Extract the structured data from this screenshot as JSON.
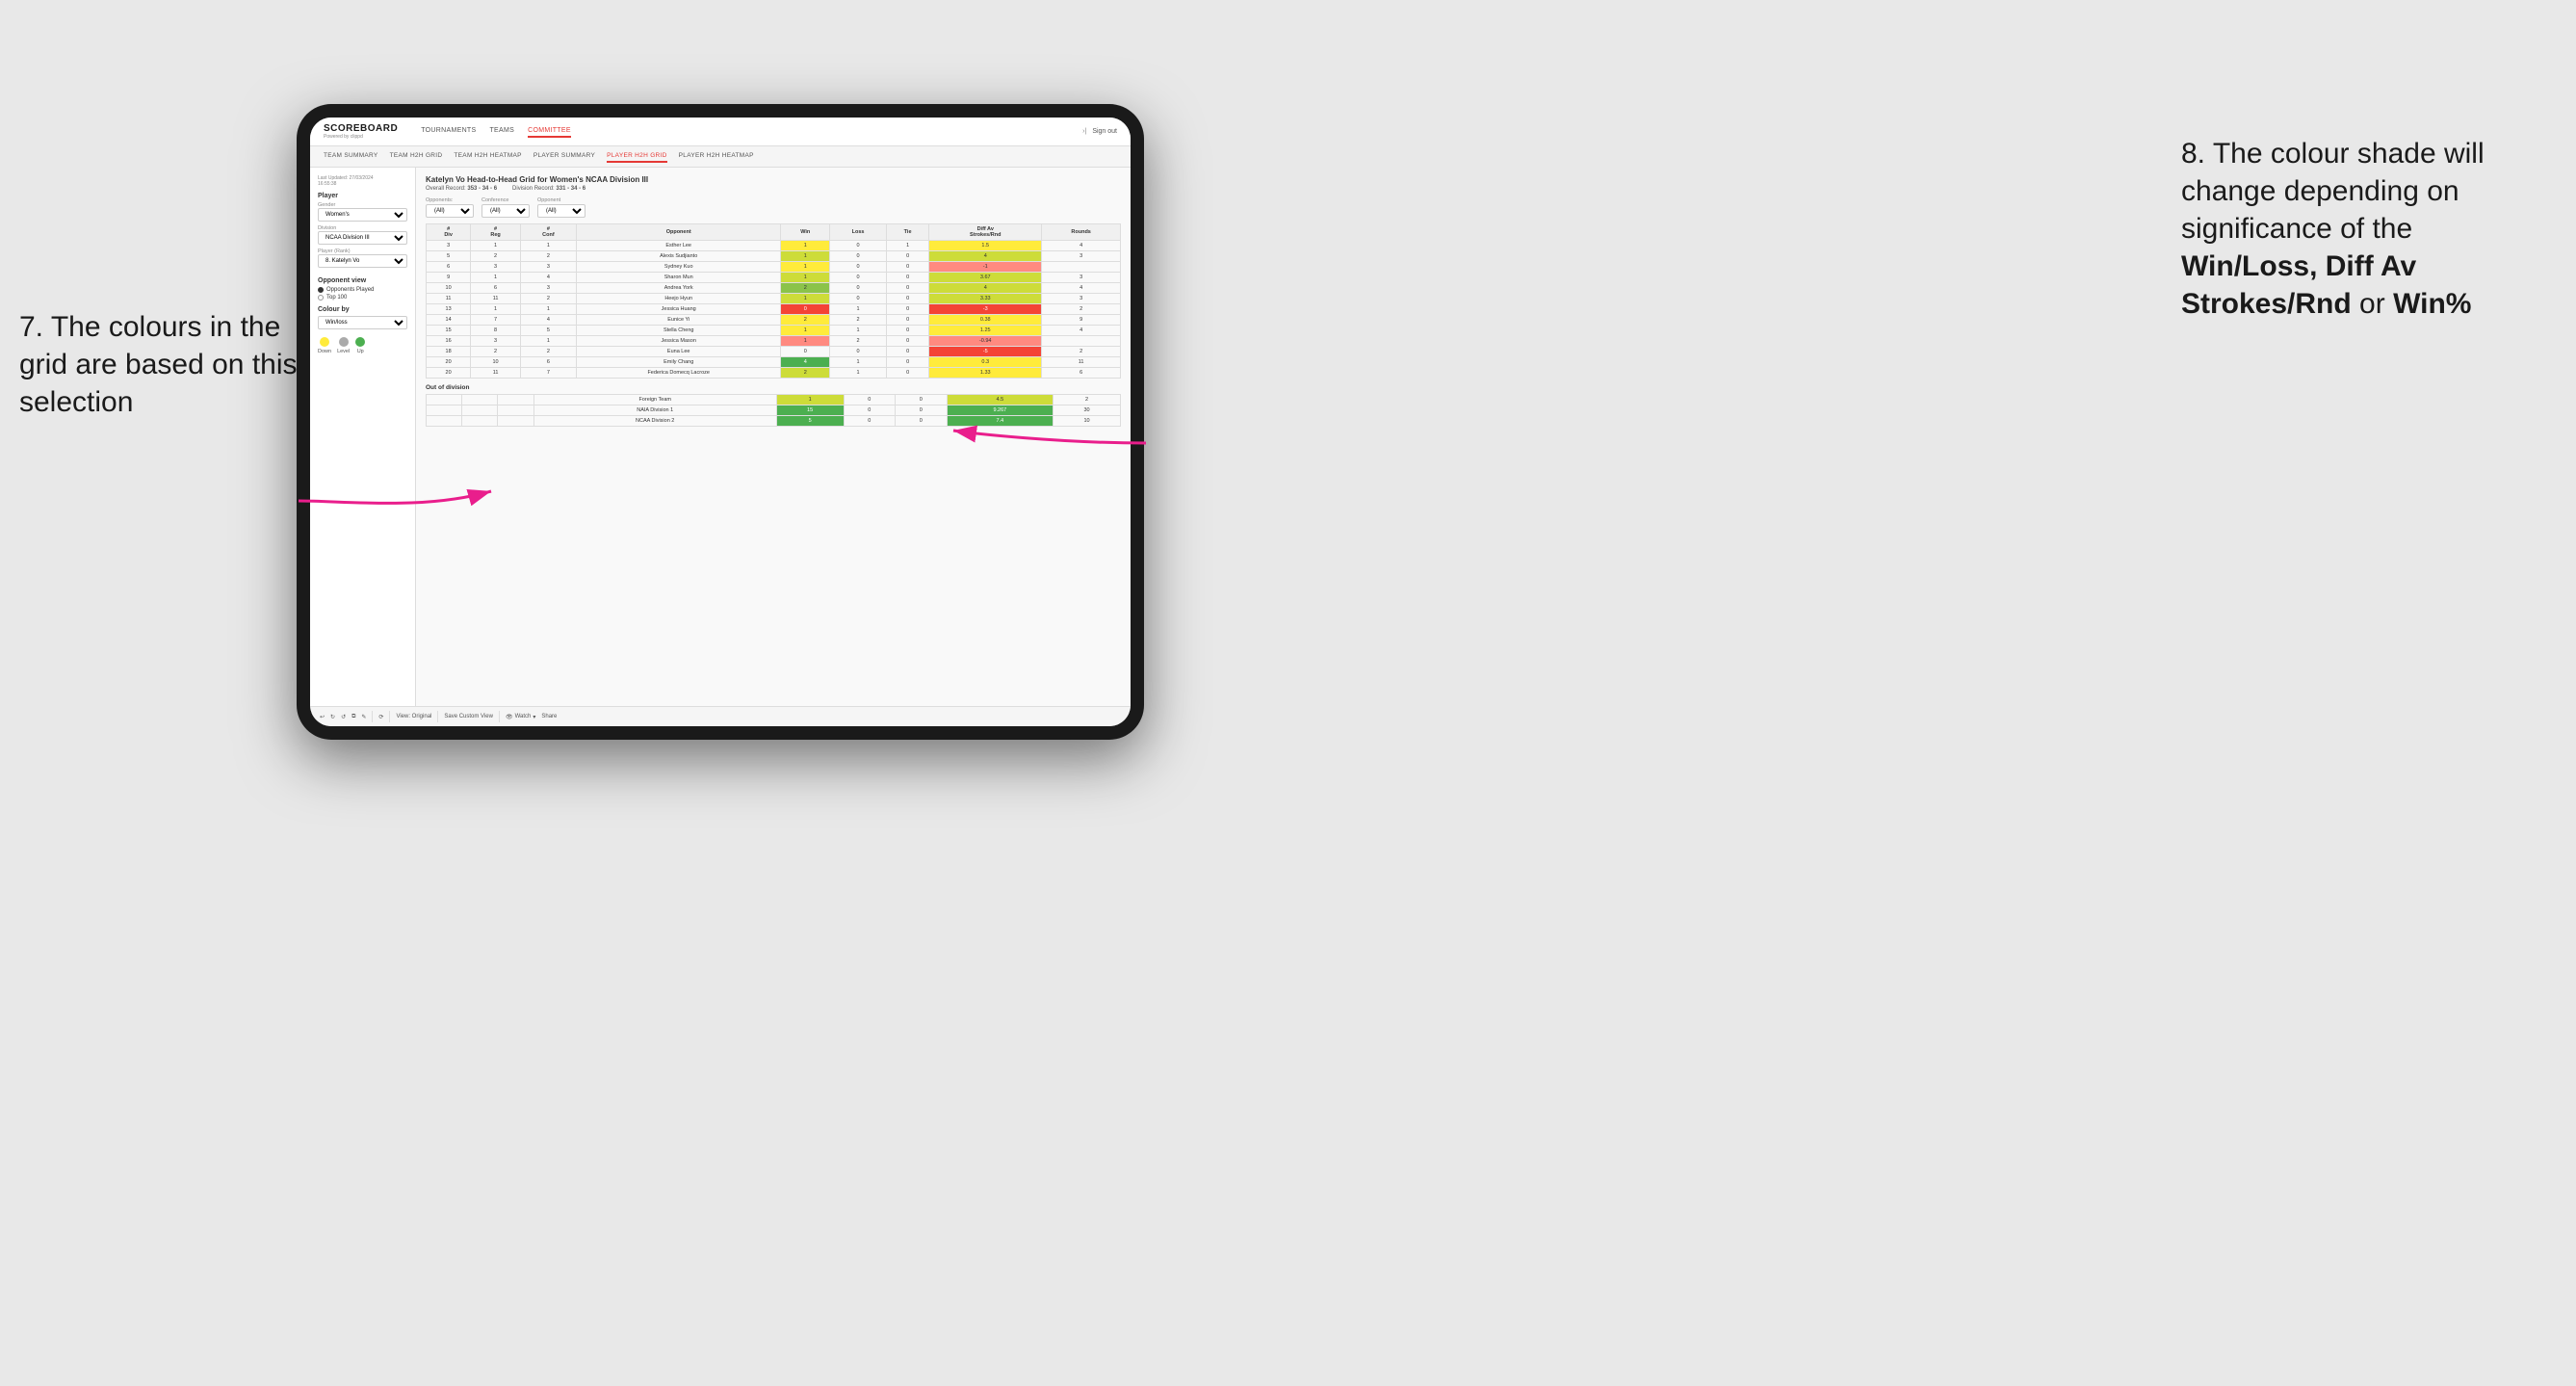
{
  "annotations": {
    "left_title": "7. The colours in the grid are based on this selection",
    "right_title": "8. The colour shade will change depending on significance of the",
    "right_bold1": "Win/Loss, Diff Av Strokes/Rnd",
    "right_bold2": "or",
    "right_bold3": "Win%"
  },
  "nav": {
    "logo": "SCOREBOARD",
    "logo_sub": "Powered by clippd",
    "items": [
      "TOURNAMENTS",
      "TEAMS",
      "COMMITTEE"
    ],
    "active_item": "COMMITTEE",
    "sign_in_icon": "›|",
    "sign_out": "Sign out"
  },
  "sub_nav": {
    "items": [
      "TEAM SUMMARY",
      "TEAM H2H GRID",
      "TEAM H2H HEATMAP",
      "PLAYER SUMMARY",
      "PLAYER H2H GRID",
      "PLAYER H2H HEATMAP"
    ],
    "active_item": "PLAYER H2H GRID"
  },
  "sidebar": {
    "last_updated_label": "Last Updated: 27/03/2024",
    "last_updated_time": "16:55:38",
    "player_section": "Player",
    "gender_label": "Gender",
    "gender_value": "Women's",
    "division_label": "Division",
    "division_value": "NCAA Division III",
    "player_rank_label": "Player (Rank)",
    "player_rank_value": "8. Katelyn Vo",
    "opponent_view_label": "Opponent view",
    "opponent_played": "Opponents Played",
    "top_100": "Top 100",
    "colour_by_label": "Colour by",
    "colour_by_value": "Win/loss",
    "legend_down": "Down",
    "legend_level": "Level",
    "legend_up": "Up"
  },
  "grid": {
    "title": "Katelyn Vo Head-to-Head Grid for Women's NCAA Division III",
    "overall_record_label": "Overall Record:",
    "overall_record": "353 - 34 - 6",
    "division_record_label": "Division Record:",
    "division_record": "331 - 34 - 6",
    "filters": {
      "opponents_label": "Opponents:",
      "opponents_value": "(All)",
      "conference_label": "Conference",
      "conference_value": "(All)",
      "opponent_label": "Opponent",
      "opponent_value": "(All)"
    },
    "table_headers": [
      "#\nDiv",
      "#\nReg",
      "#\nConf",
      "Opponent",
      "Win",
      "Loss",
      "Tie",
      "Diff Av\nStrokes/Rnd",
      "Rounds"
    ],
    "rows": [
      {
        "div": 3,
        "reg": 1,
        "conf": 1,
        "name": "Esther Lee",
        "win": 1,
        "loss": 0,
        "tie": 1,
        "diff": 1.5,
        "rounds": 4,
        "win_color": "yellow",
        "diff_color": "yellow"
      },
      {
        "div": 5,
        "reg": 2,
        "conf": 2,
        "name": "Alexis Sudjianto",
        "win": 1,
        "loss": 0,
        "tie": 0,
        "diff": 4.0,
        "rounds": 3,
        "win_color": "green-light",
        "diff_color": "green-light"
      },
      {
        "div": 6,
        "reg": 3,
        "conf": 3,
        "name": "Sydney Kuo",
        "win": 1,
        "loss": 0,
        "tie": 0,
        "diff": -1.0,
        "rounds": "",
        "win_color": "yellow",
        "diff_color": "red-light"
      },
      {
        "div": 9,
        "reg": 1,
        "conf": 4,
        "name": "Sharon Mun",
        "win": 1,
        "loss": 0,
        "tie": 0,
        "diff": 3.67,
        "rounds": 3,
        "win_color": "green-light",
        "diff_color": "green-light"
      },
      {
        "div": 10,
        "reg": 6,
        "conf": 3,
        "name": "Andrea York",
        "win": 2,
        "loss": 0,
        "tie": 0,
        "diff": 4.0,
        "rounds": 4,
        "win_color": "green-med",
        "diff_color": "green-light"
      },
      {
        "div": 11,
        "reg": 11,
        "conf": 2,
        "name": "Heejo Hyun",
        "win": 1,
        "loss": 0,
        "tie": 0,
        "diff": 3.33,
        "rounds": 3,
        "win_color": "green-light",
        "diff_color": "green-light"
      },
      {
        "div": 13,
        "reg": 1,
        "conf": 1,
        "name": "Jessica Huang",
        "win": 0,
        "loss": 1,
        "tie": 0,
        "diff": -3.0,
        "rounds": 2,
        "win_color": "red",
        "diff_color": "red"
      },
      {
        "div": 14,
        "reg": 7,
        "conf": 4,
        "name": "Eunice Yi",
        "win": 2,
        "loss": 2,
        "tie": 0,
        "diff": 0.38,
        "rounds": 9,
        "win_color": "yellow",
        "diff_color": "yellow"
      },
      {
        "div": 15,
        "reg": 8,
        "conf": 5,
        "name": "Stella Cheng",
        "win": 1,
        "loss": 1,
        "tie": 0,
        "diff": 1.25,
        "rounds": 4,
        "win_color": "yellow",
        "diff_color": "yellow"
      },
      {
        "div": 16,
        "reg": 3,
        "conf": 1,
        "name": "Jessica Mason",
        "win": 1,
        "loss": 2,
        "tie": 0,
        "diff": -0.94,
        "rounds": "",
        "win_color": "red-light",
        "diff_color": "red-light"
      },
      {
        "div": 18,
        "reg": 2,
        "conf": 2,
        "name": "Euna Lee",
        "win": 0,
        "loss": 0,
        "tie": 0,
        "diff": -5.0,
        "rounds": 2,
        "win_color": "",
        "diff_color": "red"
      },
      {
        "div": 20,
        "reg": 10,
        "conf": 6,
        "name": "Emily Chang",
        "win": 4,
        "loss": 1,
        "tie": 0,
        "diff": 0.3,
        "rounds": 11,
        "win_color": "green-dark",
        "diff_color": "yellow"
      },
      {
        "div": 20,
        "reg": 11,
        "conf": 7,
        "name": "Federica Domecq Lacroze",
        "win": 2,
        "loss": 1,
        "tie": 0,
        "diff": 1.33,
        "rounds": 6,
        "win_color": "green-light",
        "diff_color": "yellow"
      }
    ],
    "out_of_division_title": "Out of division",
    "out_of_division_rows": [
      {
        "name": "Foreign Team",
        "win": 1,
        "loss": 0,
        "tie": 0,
        "diff": 4.5,
        "rounds": 2,
        "win_color": "green-light",
        "diff_color": "green-light"
      },
      {
        "name": "NAIA Division 1",
        "win": 15,
        "loss": 0,
        "tie": 0,
        "diff": 9.267,
        "rounds": 30,
        "win_color": "green-dark",
        "diff_color": "green-dark"
      },
      {
        "name": "NCAA Division 2",
        "win": 5,
        "loss": 0,
        "tie": 0,
        "diff": 7.4,
        "rounds": 10,
        "win_color": "green-dark",
        "diff_color": "green-dark"
      }
    ]
  },
  "toolbar": {
    "view_original": "View: Original",
    "save_custom_view": "Save Custom View",
    "watch": "Watch",
    "share": "Share"
  }
}
